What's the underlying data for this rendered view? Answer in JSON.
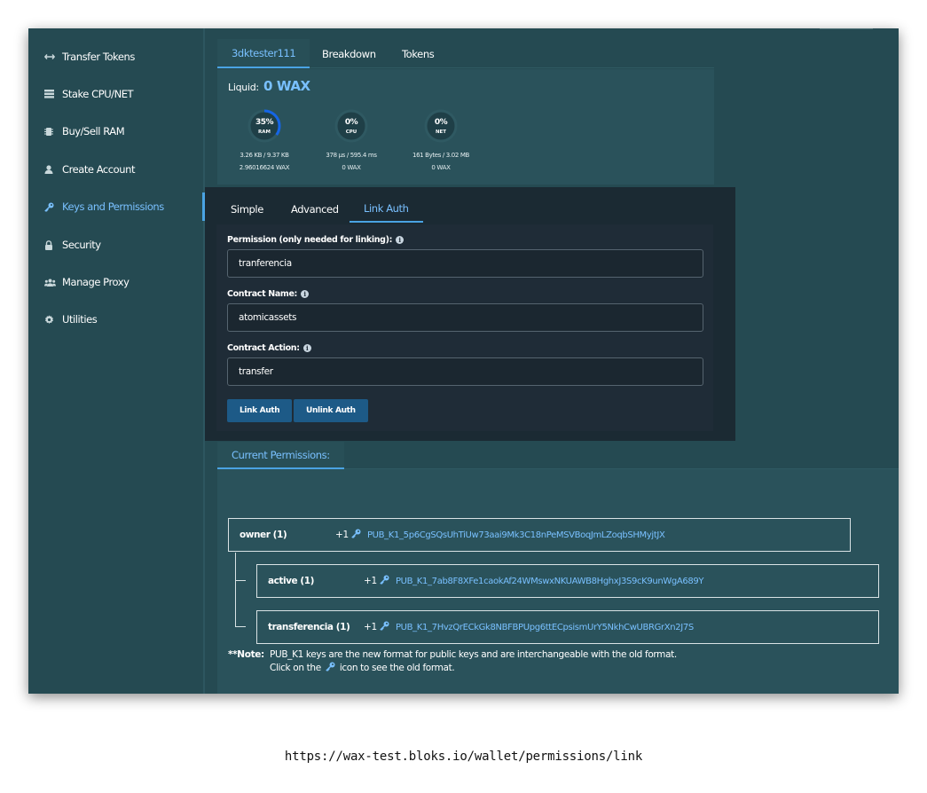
{
  "sidebar": {
    "items": [
      {
        "label": "Transfer Tokens",
        "icon": "transfer-icon"
      },
      {
        "label": "Stake CPU/NET",
        "icon": "stake-icon"
      },
      {
        "label": "Buy/Sell RAM",
        "icon": "ram-chip-icon"
      },
      {
        "label": "Create Account",
        "icon": "user-icon"
      },
      {
        "label": "Keys and Permissions",
        "icon": "key-icon"
      },
      {
        "label": "Security",
        "icon": "lock-icon"
      },
      {
        "label": "Manage Proxy",
        "icon": "users-icon"
      },
      {
        "label": "Utilities",
        "icon": "gear-icon"
      }
    ],
    "active_index": 4
  },
  "account": {
    "tabs": [
      "3dktester111",
      "Breakdown",
      "Tokens"
    ],
    "liquid_label": "Liquid:",
    "liquid_value": "0 WAX",
    "resources": [
      {
        "name": "RAM",
        "percent": "35%",
        "fraction": 0.35,
        "usage": "3.26 KB / 9.37 KB",
        "staked": "2.96016624 WAX"
      },
      {
        "name": "CPU",
        "percent": "0%",
        "fraction": 0,
        "usage": "378 µs / 595.4 ms",
        "staked": "0 WAX"
      },
      {
        "name": "NET",
        "percent": "0%",
        "fraction": 0,
        "usage": "161 Bytes / 3.02 MB",
        "staked": "0 WAX"
      }
    ]
  },
  "link_auth": {
    "tabs": [
      "Simple",
      "Advanced",
      "Link Auth"
    ],
    "permission_label": "Permission (only needed for linking):",
    "permission_value": "tranferencia",
    "contract_label": "Contract Name:",
    "contract_value": "atomicassets",
    "action_label": "Contract Action:",
    "action_value": "transfer",
    "link_button": "Link Auth",
    "unlink_button": "Unlink Auth"
  },
  "permissions": {
    "tab_label": "Current Permissions:",
    "entries": [
      {
        "name": "owner (1)",
        "weight": "+1",
        "key": "PUB_K1_5p6CgSQsUhTiUw73aai9Mk3C18nPeMSVBoqJmLZoqbSHMyjtJX"
      },
      {
        "name": "active (1)",
        "weight": "+1",
        "key": "PUB_K1_7ab8F8XFe1caokAf24WMswxNKUAWB8HghxJ3S9cK9unWgA689Y"
      },
      {
        "name": "transferencia (1)",
        "weight": "+1",
        "key": "PUB_K1_7HvzQrECkGk8NBFBPUpg6ttECpsismUrY5NkhCwUBRGrXn2J7S"
      }
    ],
    "note_label": "**Note:",
    "note_line1": "PUB_K1 keys are the new format for public keys and are interchangeable with the old format.",
    "note_line2a": "Click on the",
    "note_line2b": "icon to see the old format."
  },
  "colors": {
    "accent": "#79c0ff",
    "panel": "#254a52",
    "dark_panel": "#1b2a33",
    "button": "#1d5a87"
  },
  "url": "https://wax-test.bloks.io/wallet/permissions/link"
}
